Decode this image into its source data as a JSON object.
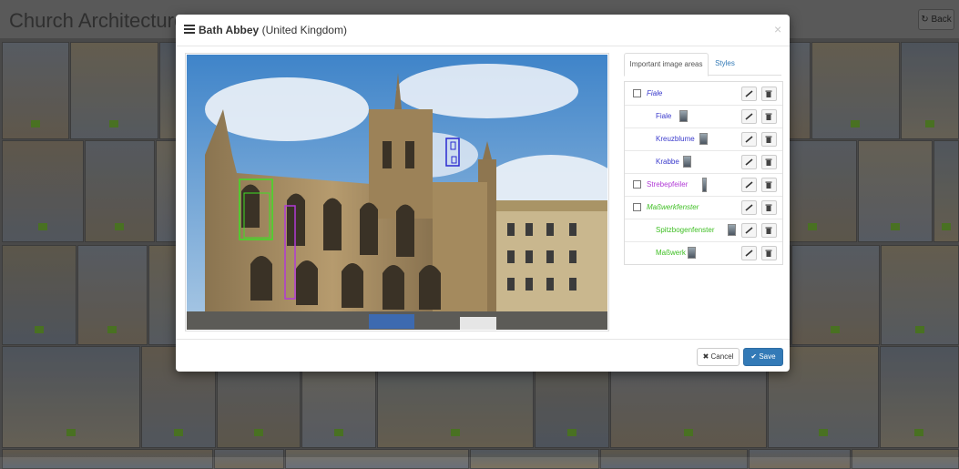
{
  "page": {
    "title": "Church Architecture",
    "back_label": "Back"
  },
  "modal": {
    "title_bold": "Bath Abbey",
    "title_rest": "(United Kingdom)",
    "close_label": "×",
    "tabs": [
      {
        "label": "Important image areas",
        "active": true
      },
      {
        "label": "Styles",
        "active": false
      }
    ],
    "areas": [
      {
        "label": "Fiale",
        "level": 0,
        "color": "#3a3acc",
        "italic": true,
        "checkbox": true,
        "thumb": false
      },
      {
        "label": "Fiale",
        "level": 1,
        "color": "#3a3acc",
        "italic": false,
        "checkbox": false,
        "thumb": true
      },
      {
        "label": "Kreuzblume",
        "level": 1,
        "color": "#3a3acc",
        "italic": false,
        "checkbox": false,
        "thumb": true
      },
      {
        "label": "Krabbe",
        "level": 1,
        "color": "#3a3acc",
        "italic": false,
        "checkbox": false,
        "thumb": true
      },
      {
        "label": "Strebepfeiler",
        "level": 0,
        "color": "#b13ad6",
        "italic": false,
        "checkbox": true,
        "thumb": true
      },
      {
        "label": "Maßwerkfenster",
        "level": 0,
        "color": "#3fbf24",
        "italic": true,
        "checkbox": true,
        "thumb": false
      },
      {
        "label": "Spitzbogenfenster",
        "level": 1,
        "color": "#3fbf24",
        "italic": false,
        "checkbox": false,
        "thumb": true
      },
      {
        "label": "Maßwerk",
        "level": 1,
        "color": "#3fbf24",
        "italic": false,
        "checkbox": false,
        "thumb": true
      }
    ],
    "cancel_label": "Cancel",
    "save_label": "Save"
  },
  "icons": {
    "header": "list-icon",
    "close": "close-icon",
    "edit": "pencil-icon",
    "delete": "trash-icon",
    "cancel": "times-icon",
    "save": "check-icon",
    "back": "refresh-icon"
  },
  "colors": {
    "primary": "#337ab7",
    "blue_box": "#2a2ad0",
    "purple_box": "#b13ad6",
    "green_box": "#3fdf24"
  }
}
